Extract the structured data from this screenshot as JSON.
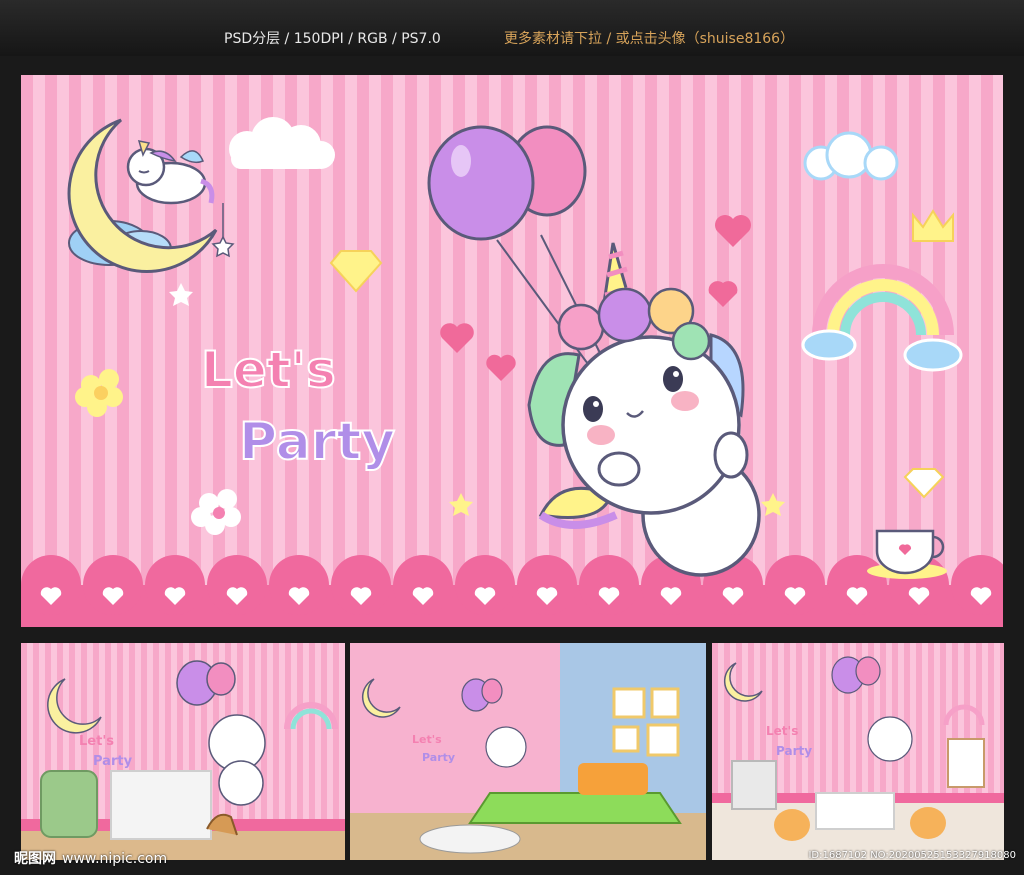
{
  "header": {
    "specs": "PSD分层 / 150DPI / RGB / PS7.0",
    "hint": "更多素材请下拉 / 或点击头像（shuise8166）"
  },
  "artwork": {
    "title_line1": "Let's",
    "title_line2": "Party",
    "colors": {
      "stripe_light": "#fbc5dc",
      "stripe_dark": "#f7a8c9",
      "border_pink": "#f0699e",
      "balloon_purple": "#c98ee8",
      "balloon_pink": "#f28ec0",
      "moon_yellow": "#faf0a0",
      "rainbow": [
        "#f6a0c8",
        "#fff38a",
        "#8fe3d9",
        "#b7d6ff"
      ]
    },
    "icons": [
      "unicorn-sleeping-on-moon-icon",
      "unicorn-with-balloons-icon",
      "cloud-icon",
      "rainbow-icon",
      "heart-icon",
      "diamond-icon",
      "crown-icon",
      "star-icon",
      "flower-icon",
      "coffee-cup-icon"
    ]
  },
  "previews": [
    {
      "name": "nursery-room-preview",
      "title_line1": "Let's",
      "title_line2": "Party"
    },
    {
      "name": "bedroom-preview",
      "title_line1": "Let's",
      "title_line2": "Party"
    },
    {
      "name": "playroom-preview",
      "title_line1": "Let's",
      "title_line2": "Party"
    }
  ],
  "watermark": {
    "site_logo": "昵图网",
    "site_url": "www.nipic.com",
    "id_text": "ID:1687102 NO:20200525153327918080"
  }
}
